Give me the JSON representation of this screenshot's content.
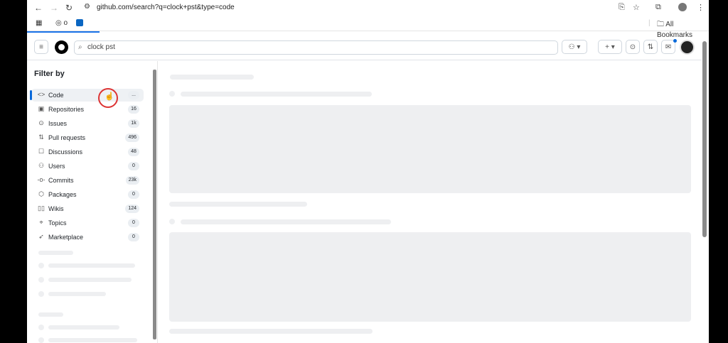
{
  "browser": {
    "url_host": "github.com",
    "url_rest": "/search?q=clock+pst&type=code",
    "bookmarks_label": "All Bookmarks",
    "bookmark_o": "o"
  },
  "header": {
    "search_value": "clock pst"
  },
  "sidebar": {
    "title": "Filter by",
    "items": [
      {
        "label": "Code",
        "count": "...",
        "icon": "code-icon"
      },
      {
        "label": "Repositories",
        "count": "16",
        "icon": "repo-icon"
      },
      {
        "label": "Issues",
        "count": "1k",
        "icon": "issue-icon"
      },
      {
        "label": "Pull requests",
        "count": "496",
        "icon": "pull-request-icon"
      },
      {
        "label": "Discussions",
        "count": "48",
        "icon": "discussion-icon"
      },
      {
        "label": "Users",
        "count": "0",
        "icon": "people-icon"
      },
      {
        "label": "Commits",
        "count": "23k",
        "icon": "commit-icon"
      },
      {
        "label": "Packages",
        "count": "0",
        "icon": "package-icon"
      },
      {
        "label": "Wikis",
        "count": "124",
        "icon": "book-icon"
      },
      {
        "label": "Topics",
        "count": "0",
        "icon": "tag-icon"
      },
      {
        "label": "Marketplace",
        "count": "0",
        "icon": "rocket-icon"
      }
    ]
  }
}
